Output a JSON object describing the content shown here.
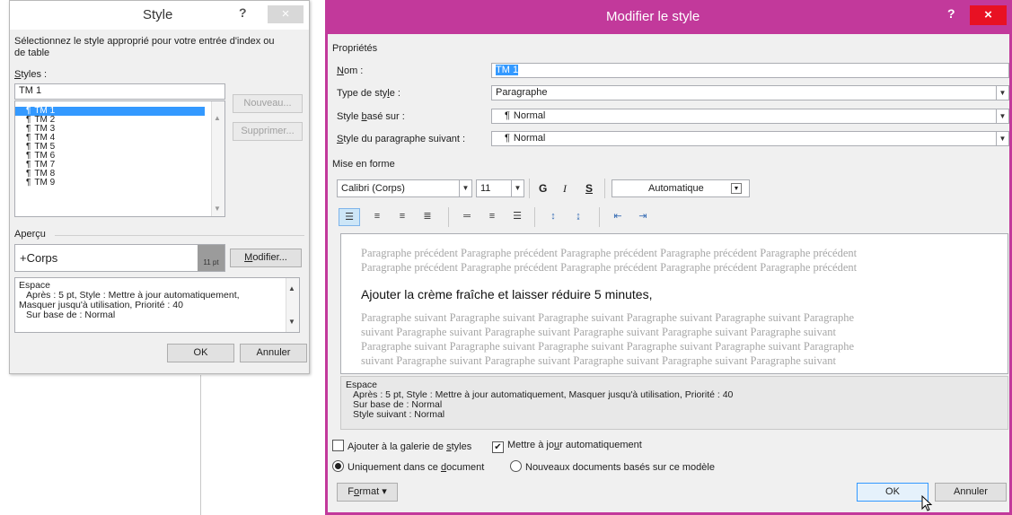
{
  "style_dialog": {
    "title": "Style",
    "help": "?",
    "close": "×",
    "instructions": "Sélectionnez le style approprié pour votre entrée d'index ou de table",
    "styles_label": "Styles :",
    "styles_input": "TM 1",
    "style_items": [
      "TM 1",
      "TM 2",
      "TM 3",
      "TM 4",
      "TM 5",
      "TM 6",
      "TM 7",
      "TM 8",
      "TM 9"
    ],
    "pilcrow": "¶",
    "new_btn": "Nouveau...",
    "delete_btn": "Supprimer...",
    "preview_label": "Aperçu",
    "preview_text": "+Corps",
    "preview_size": "11 pt",
    "modify_btn": "Modifier...",
    "desc": [
      "Espace",
      "Après : 5 pt, Style : Mettre à jour automatiquement,",
      "Masquer jusqu'à utilisation, Priorité : 40",
      "Sur base de : Normal"
    ],
    "ok": "OK",
    "cancel": "Annuler"
  },
  "modify_dialog": {
    "title": "Modifier le style",
    "help": "?",
    "close": "×",
    "properties_label": "Propriétés",
    "name_label": "Nom :",
    "name_value": "TM 1",
    "type_label": "Type de style :",
    "type_value": "Paragraphe",
    "based_label": "Style basé sur :",
    "based_value": "Normal",
    "next_label": "Style du paragraphe suivant :",
    "next_value": "Normal",
    "format_label": "Mise en forme",
    "font": "Calibri (Corps)",
    "size": "11",
    "bold": "G",
    "italic": "I",
    "underline": "S",
    "color": "Automatique",
    "preview_prev": [
      "Paragraphe précédent Paragraphe précédent Paragraphe précédent Paragraphe précédent Paragraphe précédent",
      "Paragraphe précédent Paragraphe précédent Paragraphe précédent Paragraphe précédent Paragraphe précédent"
    ],
    "preview_main": "Ajouter la crème fraîche et laisser réduire 5 minutes,",
    "preview_next": [
      "Paragraphe suivant Paragraphe suivant Paragraphe suivant Paragraphe suivant Paragraphe suivant Paragraphe",
      "suivant Paragraphe suivant Paragraphe suivant Paragraphe suivant Paragraphe suivant Paragraphe suivant",
      "Paragraphe suivant Paragraphe suivant Paragraphe suivant Paragraphe suivant Paragraphe suivant Paragraphe",
      "suivant Paragraphe suivant Paragraphe suivant Paragraphe suivant Paragraphe suivant Paragraphe suivant"
    ],
    "desc": [
      "Espace",
      "Après : 5 pt, Style : Mettre à jour automatiquement, Masquer jusqu'à utilisation, Priorité : 40",
      "Sur base de : Normal",
      "Style suivant : Normal"
    ],
    "add_gallery": "Ajouter à la galerie de styles",
    "auto_update": "Mettre à jour automatiquement",
    "only_doc": "Uniquement dans ce document",
    "new_docs": "Nouveaux documents basés sur ce modèle",
    "format_btn": "Format ▾",
    "ok": "OK",
    "cancel": "Annuler"
  },
  "colors": {
    "accent": "#c2399b",
    "selection": "#3399ff",
    "close": "#e81123"
  }
}
